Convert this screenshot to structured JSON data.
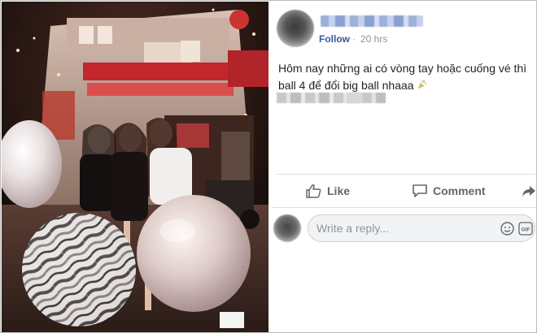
{
  "post": {
    "author_name": "",
    "follow_label": "Follow",
    "separator": "·",
    "time": "20 hrs",
    "text": "Hôm nay những ai có vòng tay hoặc cuống vé thì ball 4 để đổi big ball nhaaa",
    "emoji_icon": "party-popper-icon"
  },
  "actions": {
    "like_label": "Like",
    "comment_label": "Comment",
    "share_icon": "share-icon"
  },
  "reply": {
    "placeholder": "Write a reply...",
    "emoji_icon": "smiley-icon",
    "gif_label": "GIF"
  },
  "photo": {
    "description_icon": "photo"
  },
  "colors": {
    "link": "#365899",
    "meta": "#90949c",
    "action": "#606770",
    "divider": "#dddfe2"
  }
}
